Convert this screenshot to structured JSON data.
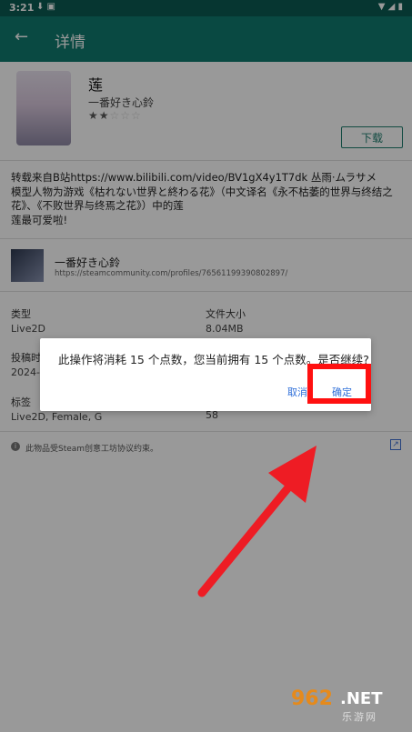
{
  "status_bar": {
    "time": "3:21",
    "left_icons": "⬇ ▣",
    "right_icons": "▼ ◢ ▮"
  },
  "appbar": {
    "title": "详情",
    "back_icon": "arrow-left-icon"
  },
  "item": {
    "name": "莲",
    "subtitle": "一番好き心鈴",
    "rating_full": "★★",
    "rating_empty": "☆☆☆",
    "rating_value": 2.5,
    "download_label": "下载"
  },
  "description": [
    "转载来自B站https://www.bilibili.com/video/BV1gX4y1T7dk 丛雨·ムラサメ",
    "模型人物为游戏《枯れない世界と終わる花》（中文译名《永不枯萎的世界与终结之花》、《不败世界与终焉之花》）中的莲",
    "莲最可爱啦!"
  ],
  "author": {
    "name": "一番好き心鈴",
    "link": "https://steamcommunity.com/profiles/76561199390802897/"
  },
  "meta": {
    "type_label": "类型",
    "type_value": "Live2D",
    "size_label": "文件大小",
    "size_value": "8.04MB",
    "posted_label": "投稿时",
    "posted_value": "2024-0",
    "tags_label": "标签",
    "tags_value": "Live2D, Female, G",
    "extra_value": "58"
  },
  "notice": {
    "text": "此物品受Steam创意工坊协议约束。"
  },
  "dialog": {
    "message": "此操作将消耗 15 个点数，您当前拥有 15 个点数。是否继续?",
    "cancel_label": "取消",
    "ok_label": "确定"
  },
  "watermark": {
    "brand": "962",
    "domain": ".NET",
    "cn_name": "乐游网"
  },
  "colors": {
    "appbar": "#0f7a6e",
    "accent": "#1f7d6f",
    "highlight": "#ff1010",
    "link": "#2f6fd9"
  }
}
